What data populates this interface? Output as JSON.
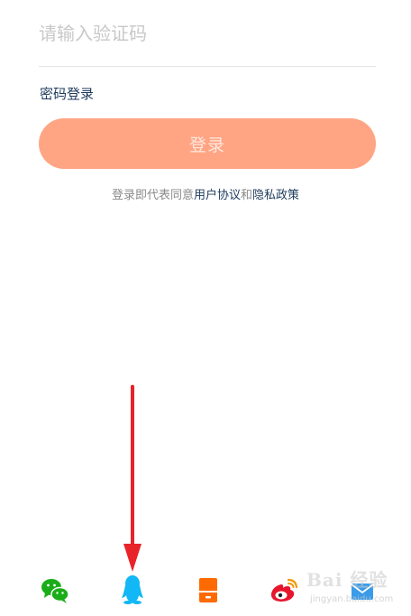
{
  "verification": {
    "placeholder": "请输入验证码"
  },
  "password_login_label": "密码登录",
  "login_button_label": "登录",
  "agreement": {
    "prefix": "登录即代表同意",
    "user_agreement": "用户协议",
    "and": "和",
    "privacy_policy": "隐私政策"
  },
  "social_login": [
    {
      "name": "wechat-icon",
      "color": "#1aad19"
    },
    {
      "name": "qq-icon",
      "color": "#12b7f5"
    },
    {
      "name": "phone-icon",
      "color": "#ff6a00"
    },
    {
      "name": "weibo-icon",
      "color": "#e6162d"
    },
    {
      "name": "mail-icon",
      "color": "#3a9be8"
    }
  ],
  "annotation": {
    "arrow_color": "#e8232a"
  },
  "watermark": {
    "title": "Bai 经验",
    "url": "jingyan.baidu.com"
  },
  "colors": {
    "login_button_bg": "#ffa584",
    "link_color": "#1f3a5c",
    "placeholder_color": "#c8c8c8"
  }
}
